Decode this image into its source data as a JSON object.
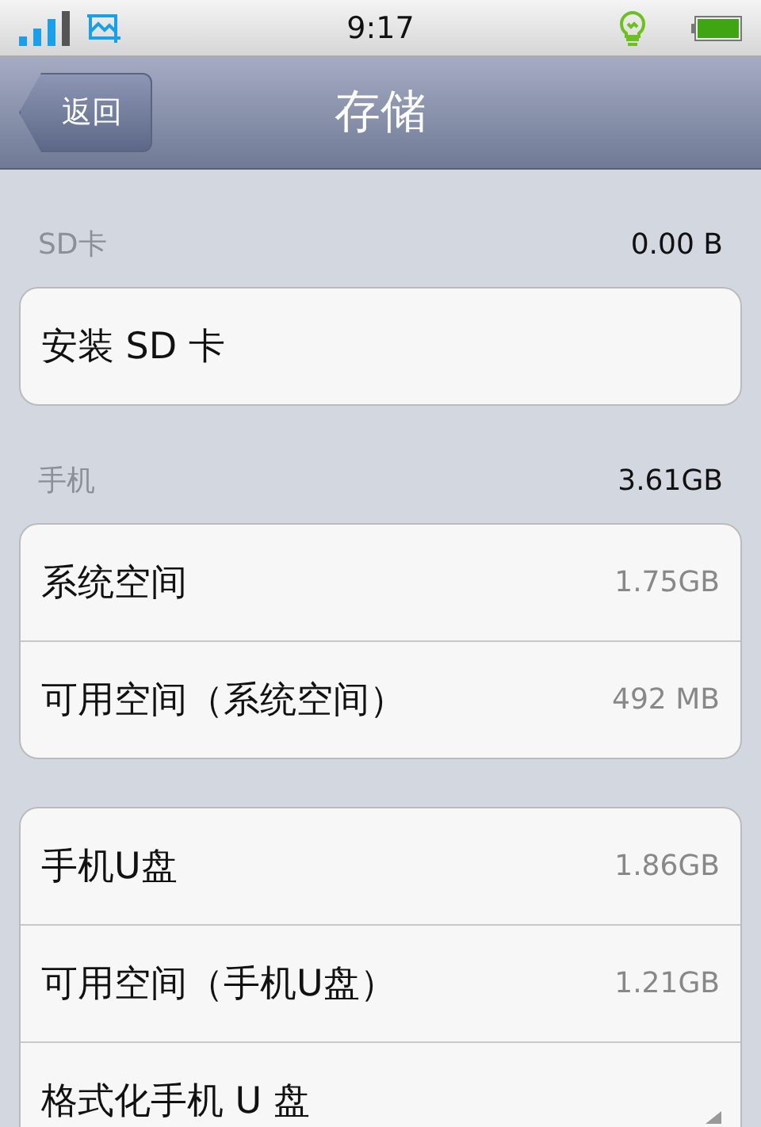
{
  "status_bar": {
    "time": "9:17"
  },
  "nav": {
    "back": "返回",
    "title": "存储"
  },
  "sections": [
    {
      "header": {
        "label": "SD卡",
        "value": "0.00 B"
      },
      "rows": [
        {
          "kind": "plain",
          "label": "安装 SD 卡"
        }
      ]
    },
    {
      "header": {
        "label": "手机",
        "value": "3.61GB"
      },
      "rows": [
        {
          "kind": "value",
          "label": "系统空间",
          "value": "1.75GB"
        },
        {
          "kind": "value",
          "label": "可用空间（系统空间）",
          "value": "492 MB"
        }
      ]
    },
    {
      "rows": [
        {
          "kind": "value",
          "label": "手机U盘",
          "value": "1.86GB"
        },
        {
          "kind": "value",
          "label": "可用空间（手机U盘）",
          "value": "1.21GB"
        },
        {
          "kind": "corner",
          "label": "格式化手机 U 盘"
        }
      ]
    }
  ]
}
